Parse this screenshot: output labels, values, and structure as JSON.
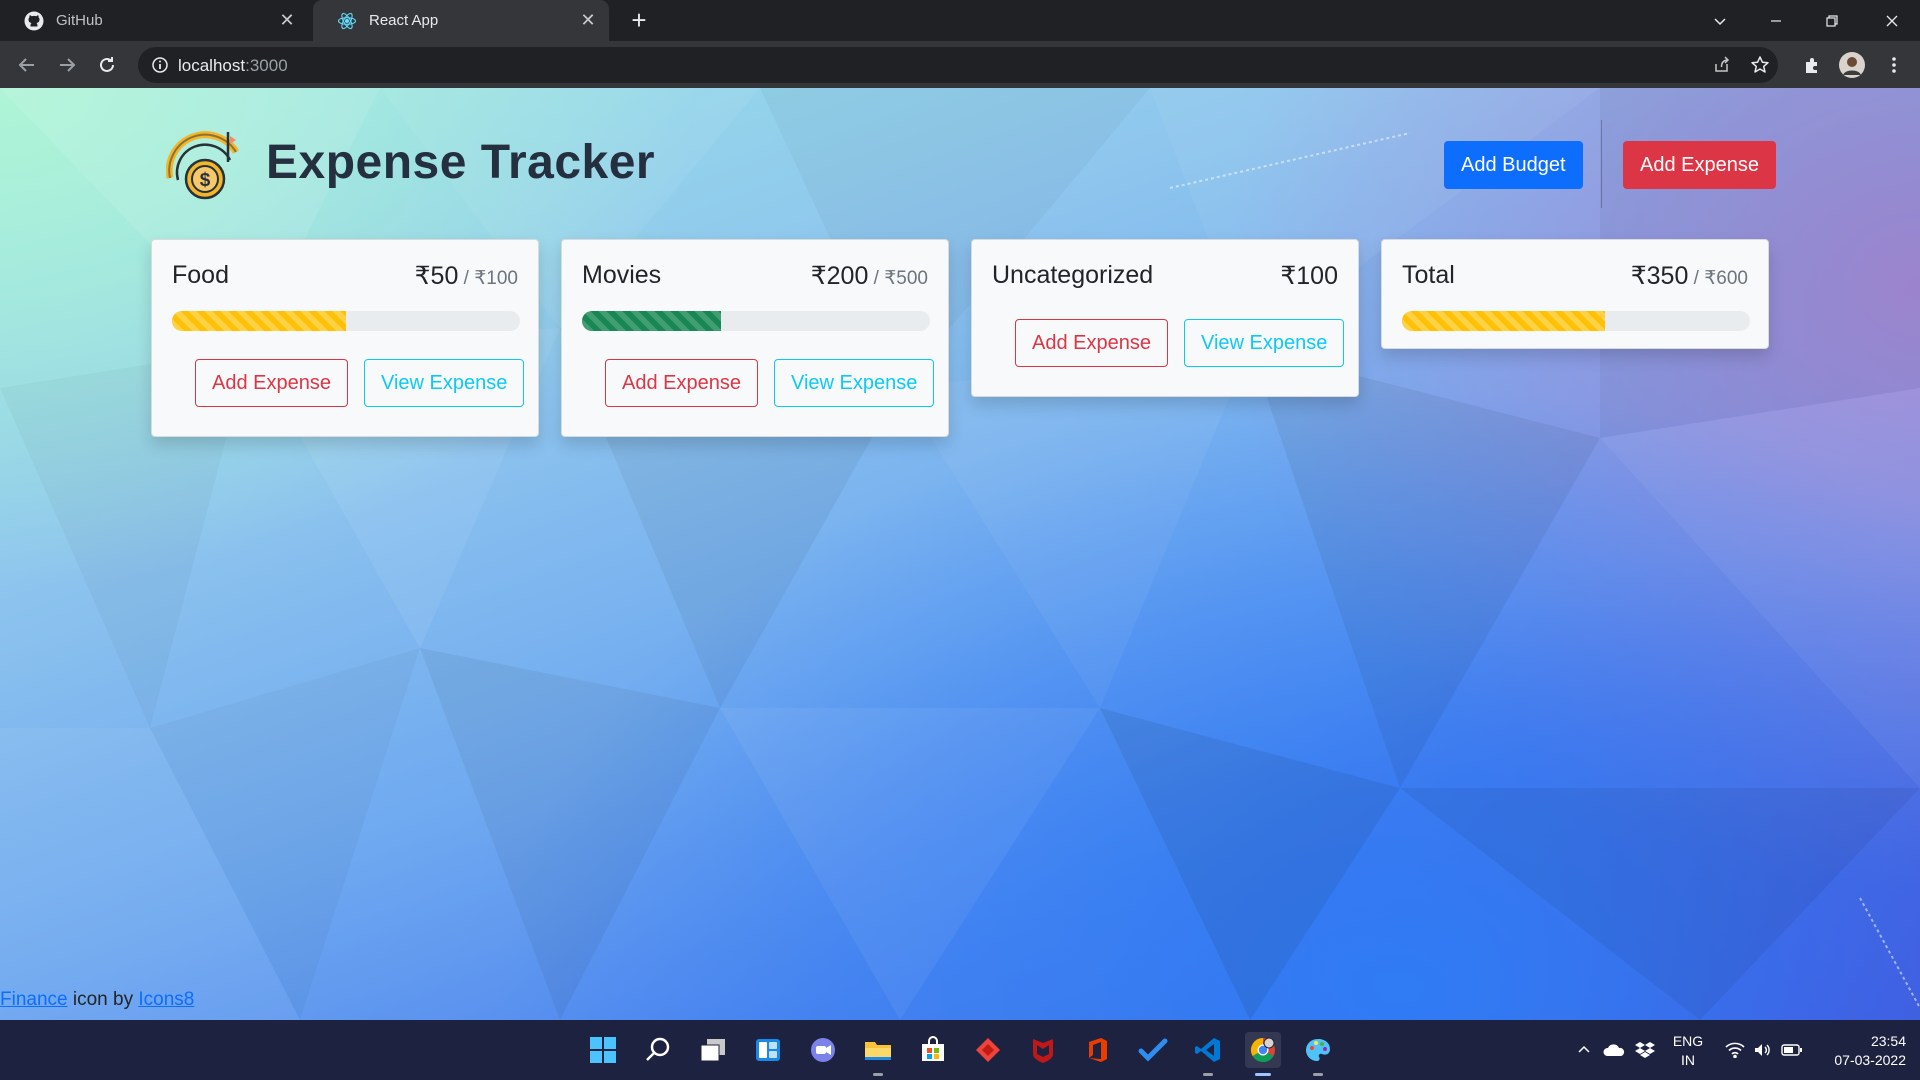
{
  "browser": {
    "tabs": [
      {
        "title": "GitHub",
        "icon": "github-icon",
        "active": false
      },
      {
        "title": "React App",
        "icon": "react-icon",
        "active": true
      }
    ],
    "url_host": "localhost",
    "url_port": ":3000"
  },
  "header": {
    "title": "Expense Tracker",
    "add_budget_label": "Add Budget",
    "add_expense_label": "Add Expense"
  },
  "cards": [
    {
      "name": "Food",
      "amount": "₹50",
      "max": " / ₹100",
      "progress": 0.5,
      "progress_color": "warning",
      "add_label": "Add Expense",
      "view_label": "View Expense"
    },
    {
      "name": "Movies",
      "amount": "₹200",
      "max": " / ₹500",
      "progress": 0.4,
      "progress_color": "success",
      "add_label": "Add Expense",
      "view_label": "View Expense"
    },
    {
      "name": "Uncategorized",
      "amount": "₹100",
      "add_label": "Add Expense",
      "view_label": "View Expense"
    },
    {
      "name": "Total",
      "amount": "₹350",
      "max": " / ₹600",
      "progress": 0.5833,
      "progress_color": "warning"
    }
  ],
  "credit": {
    "link1": "Finance",
    "middle": " icon by ",
    "link2": "Icons8"
  },
  "taskbar": {
    "apps": [
      "windows-start-icon",
      "search-icon",
      "task-view-icon",
      "widgets-icon",
      "teams-chat-icon",
      "file-explorer-icon",
      "store-icon",
      "anydesk-icon",
      "mcafee-icon",
      "office-icon",
      "todo-icon",
      "vscode-icon",
      "chrome-icon",
      "paint-icon"
    ],
    "lang_line1": "ENG",
    "lang_line2": "IN",
    "time": "23:54",
    "date": "07-03-2022"
  },
  "colors": {
    "primary": "#0d6efd",
    "danger": "#dc3545",
    "info": "#0dcaf0",
    "warning": "#ffc107",
    "success": "#198754"
  }
}
